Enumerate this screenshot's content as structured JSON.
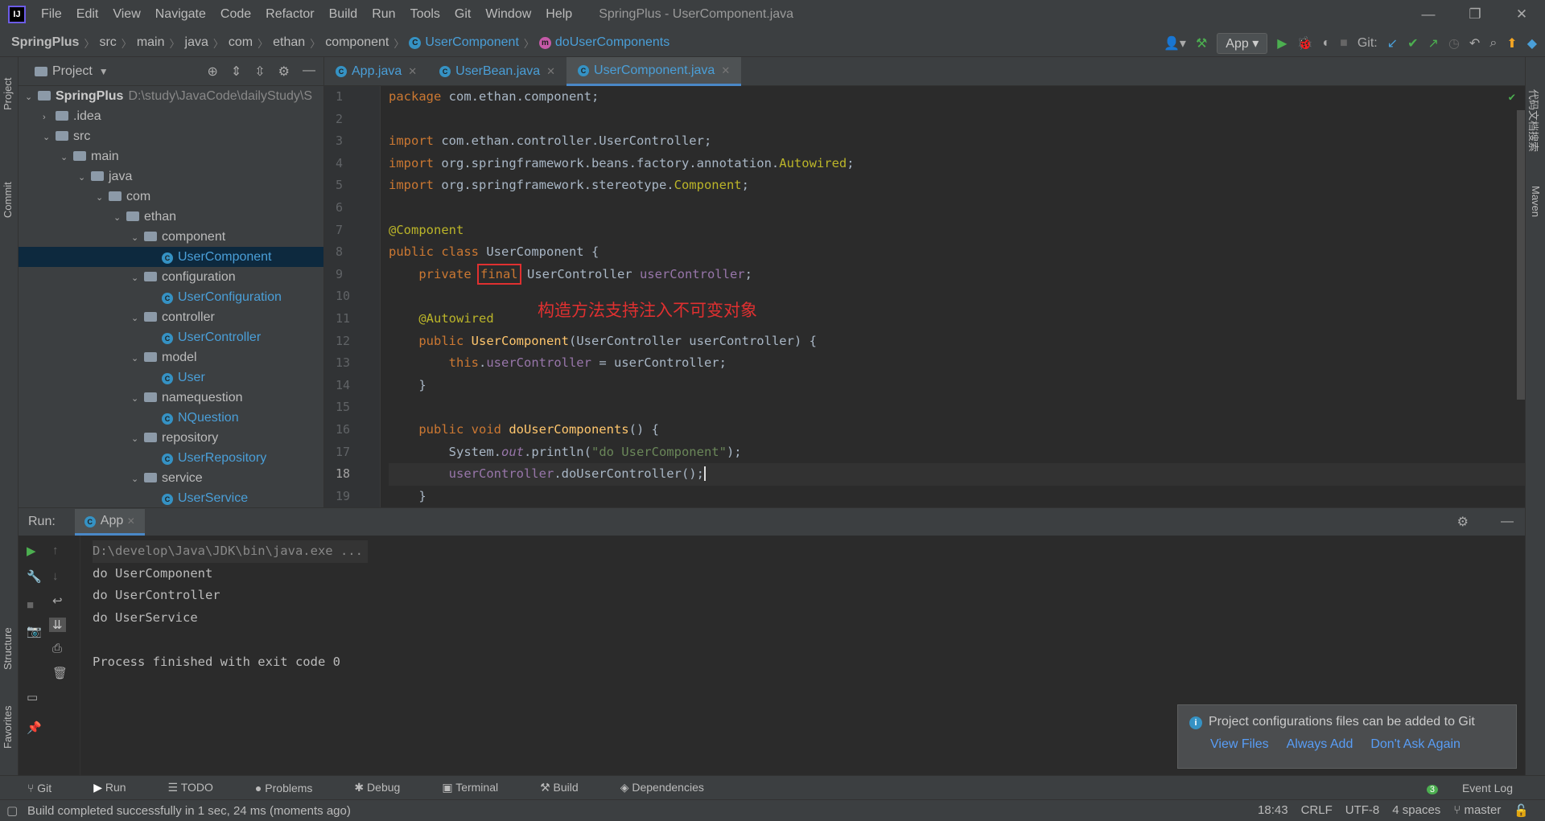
{
  "window": {
    "menu": [
      "File",
      "Edit",
      "View",
      "Navigate",
      "Code",
      "Refactor",
      "Build",
      "Run",
      "Tools",
      "Git",
      "Window",
      "Help"
    ],
    "title": "SpringPlus - UserComponent.java"
  },
  "breadcrumb": [
    "SpringPlus",
    "src",
    "main",
    "java",
    "com",
    "ethan",
    "component",
    "UserComponent",
    "doUserComponents"
  ],
  "toolbar": {
    "run_config": "App",
    "git_label": "Git:"
  },
  "project_panel": {
    "title": "Project",
    "root_name": "SpringPlus",
    "root_path": "D:\\study\\JavaCode\\dailyStudy\\S",
    "tree": [
      {
        "label": ".idea",
        "depth": 1,
        "kind": "folder",
        "open": false
      },
      {
        "label": "src",
        "depth": 1,
        "kind": "folder",
        "open": true
      },
      {
        "label": "main",
        "depth": 2,
        "kind": "folder",
        "open": true
      },
      {
        "label": "java",
        "depth": 3,
        "kind": "folder",
        "open": true
      },
      {
        "label": "com",
        "depth": 4,
        "kind": "folder",
        "open": true
      },
      {
        "label": "ethan",
        "depth": 5,
        "kind": "folder",
        "open": true
      },
      {
        "label": "component",
        "depth": 6,
        "kind": "folder",
        "open": true
      },
      {
        "label": "UserComponent",
        "depth": 7,
        "kind": "class",
        "selected": true
      },
      {
        "label": "configuration",
        "depth": 6,
        "kind": "folder",
        "open": true
      },
      {
        "label": "UserConfiguration",
        "depth": 7,
        "kind": "class"
      },
      {
        "label": "controller",
        "depth": 6,
        "kind": "folder",
        "open": true
      },
      {
        "label": "UserController",
        "depth": 7,
        "kind": "class"
      },
      {
        "label": "model",
        "depth": 6,
        "kind": "folder",
        "open": true
      },
      {
        "label": "User",
        "depth": 7,
        "kind": "class"
      },
      {
        "label": "namequestion",
        "depth": 6,
        "kind": "folder",
        "open": true
      },
      {
        "label": "NQuestion",
        "depth": 7,
        "kind": "class"
      },
      {
        "label": "repository",
        "depth": 6,
        "kind": "folder",
        "open": true
      },
      {
        "label": "UserRepository",
        "depth": 7,
        "kind": "class"
      },
      {
        "label": "service",
        "depth": 6,
        "kind": "folder",
        "open": true
      },
      {
        "label": "UserService",
        "depth": 7,
        "kind": "class"
      }
    ]
  },
  "editor_tabs": [
    {
      "label": "App.java",
      "active": false
    },
    {
      "label": "UserBean.java",
      "active": false
    },
    {
      "label": "UserComponent.java",
      "active": true
    }
  ],
  "code": {
    "line_numbers": [
      "1",
      "2",
      "3",
      "4",
      "5",
      "6",
      "7",
      "8",
      "9",
      "10",
      "11",
      "12",
      "13",
      "14",
      "15",
      "16",
      "17",
      "18",
      "19"
    ],
    "current_line": "18",
    "annotation_text": "构造方法支持注入不可变对象"
  },
  "run_panel": {
    "label": "Run:",
    "tab": "App",
    "console": [
      "D:\\develop\\Java\\JDK\\bin\\java.exe ...",
      "do UserComponent",
      "do UserController",
      "do UserService",
      "",
      "Process finished with exit code 0"
    ]
  },
  "left_strip": [
    "Project",
    "Commit",
    "Structure",
    "Favorites"
  ],
  "right_strip": [
    "代码文档搜索",
    "Maven"
  ],
  "bottom_tabs": [
    "Git",
    "Run",
    "TODO",
    "Problems",
    "Debug",
    "Terminal",
    "Build",
    "Dependencies"
  ],
  "event_log": {
    "label": "Event Log",
    "count": "3"
  },
  "status": {
    "message": "Build completed successfully in 1 sec, 24 ms (moments ago)",
    "position": "18:43",
    "line_sep": "CRLF",
    "encoding": "UTF-8",
    "indent": "4 spaces",
    "branch": "master"
  },
  "notification": {
    "message": "Project configurations files can be added to Git",
    "actions": [
      "View Files",
      "Always Add",
      "Don't Ask Again"
    ]
  }
}
